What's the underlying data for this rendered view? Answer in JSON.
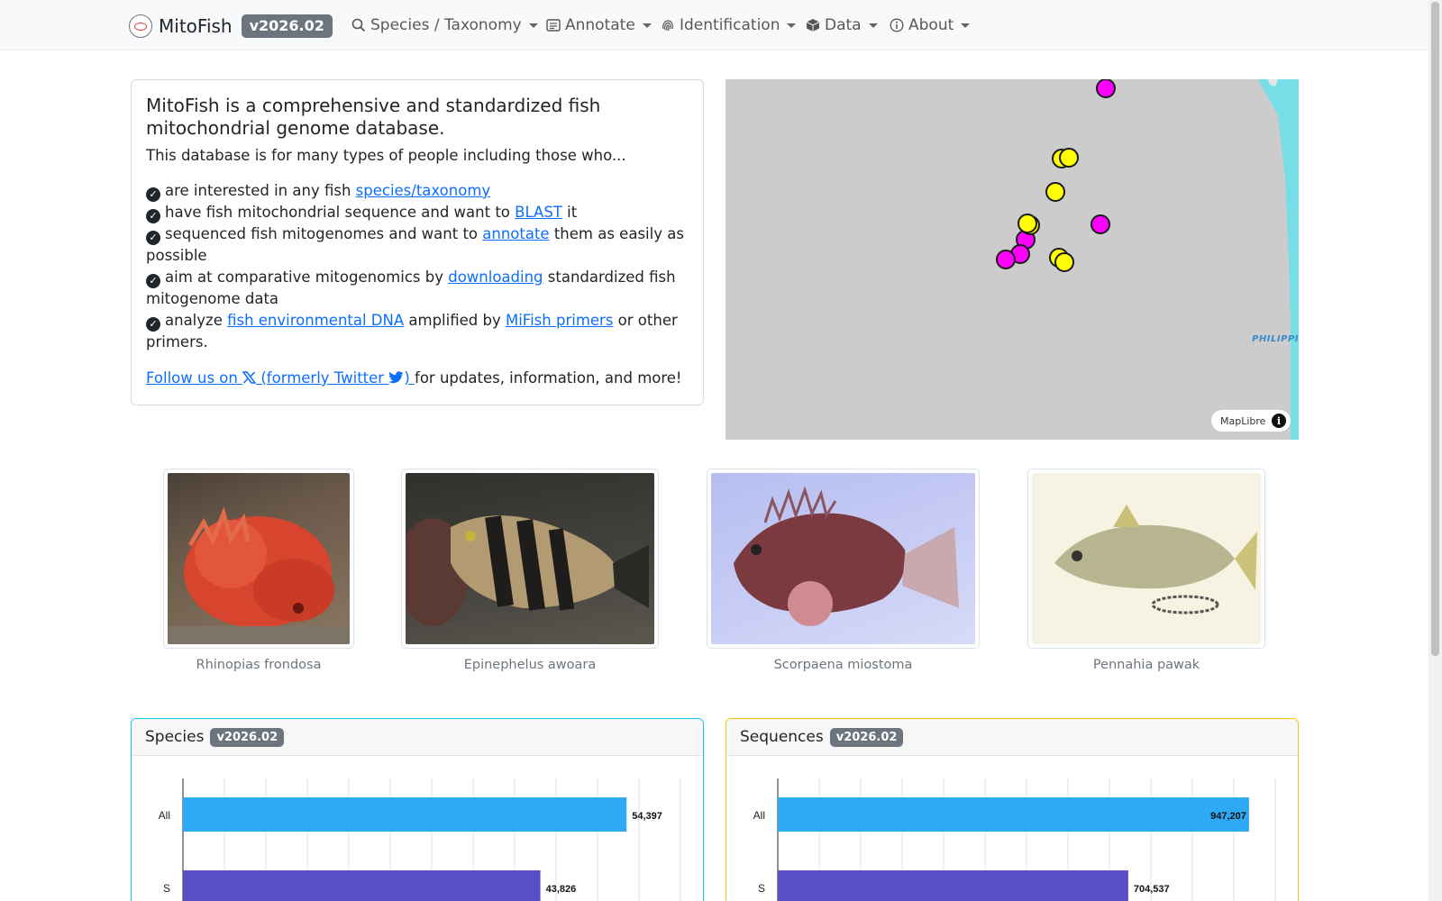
{
  "navbar": {
    "brand": "MitoFish",
    "version": "v2026.02",
    "items": [
      {
        "label": "Species / Taxonomy",
        "icon": "search-icon"
      },
      {
        "label": "Annotate",
        "icon": "card-text-icon"
      },
      {
        "label": "Identification",
        "icon": "fingerprint-icon"
      },
      {
        "label": "Data",
        "icon": "box-icon"
      },
      {
        "label": "About",
        "icon": "info-icon"
      }
    ]
  },
  "intro": {
    "title": "MitoFish is a comprehensive and standardized fish mitochondrial genome database.",
    "subtitle": "This database is for many types of people including those who...",
    "items": [
      {
        "pre": "are interested in any fish ",
        "link": "species/taxonomy",
        "post": ""
      },
      {
        "pre": "have fish mitochondrial sequence and want to ",
        "link": "BLAST",
        "post": " it"
      },
      {
        "pre": "sequenced fish mitogenomes and want to ",
        "link": "annotate",
        "post": " them as easily as possible"
      },
      {
        "pre": "aim at comparative mitogenomics by ",
        "link": "downloading",
        "post": " standardized fish mitogenome data"
      },
      {
        "pre": "analyze ",
        "link": "fish environmental DNA",
        "mid": " amplified by ",
        "link2": "MiFish primers",
        "post": " or other primers."
      }
    ],
    "follow_link_pre": "Follow us on ",
    "follow_link_post": " (formerly Twitter ",
    "follow_link_end": ") ",
    "follow_suffix": "for updates, information, and more!"
  },
  "map": {
    "attribution": "MapLibre",
    "sea_label": "PHILIPPI",
    "land_color": "#cccccc",
    "sea_color": "#77dde7"
  },
  "gallery": [
    {
      "caption": "Rhinopias frondosa"
    },
    {
      "caption": "Epinephelus awoara"
    },
    {
      "caption": "Scorpaena miostoma"
    },
    {
      "caption": "Pennahia pawak"
    }
  ],
  "species_card": {
    "title": "Species",
    "version": "v2026.02",
    "border_color": "#0dcaf0"
  },
  "sequences_card": {
    "title": "Sequences",
    "version": "v2026.02",
    "border_color": "#ffc107"
  },
  "chart_data": [
    {
      "type": "bar",
      "orientation": "horizontal",
      "categories": [
        "All",
        "S"
      ],
      "values": [
        54397,
        43826
      ],
      "value_labels": [
        "54,397",
        "43,826"
      ],
      "colors": [
        "#2ea9f5",
        "#5a4ec7"
      ],
      "xlim": [
        0,
        61000
      ],
      "grid": true
    },
    {
      "type": "bar",
      "orientation": "horizontal",
      "categories": [
        "All",
        "S"
      ],
      "values": [
        947207,
        704537
      ],
      "value_labels": [
        "947,207",
        "704,537"
      ],
      "colors": [
        "#2ea9f5",
        "#5a4ec7"
      ],
      "xlim": [
        0,
        1000000
      ],
      "grid": true
    }
  ]
}
